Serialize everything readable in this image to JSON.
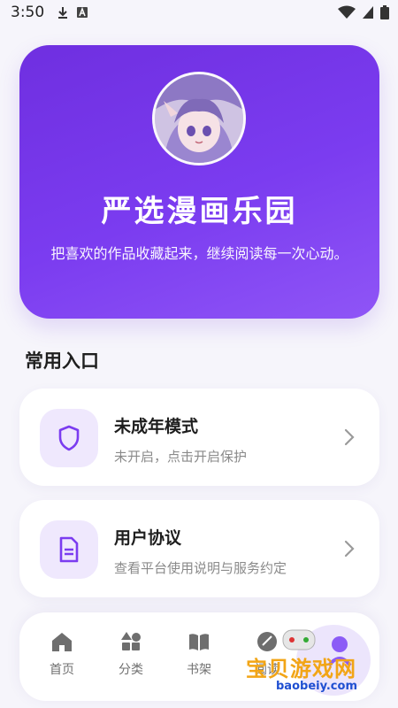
{
  "status_bar": {
    "time": "3:50"
  },
  "hero": {
    "title": "严选漫画乐园",
    "subtitle": "把喜欢的作品收藏起来，继续阅读每一次心动。"
  },
  "section": {
    "title": "常用入口"
  },
  "entries": [
    {
      "title": "未成年模式",
      "desc": "未开启，点击开启保护",
      "icon": "shield-icon"
    },
    {
      "title": "用户协议",
      "desc": "查看平台使用说明与服务约定",
      "icon": "document-icon"
    }
  ],
  "nav": [
    {
      "label": "首页",
      "icon": "home-icon"
    },
    {
      "label": "分类",
      "icon": "category-icon"
    },
    {
      "label": "书架",
      "icon": "book-icon"
    },
    {
      "label": "阅读",
      "icon": "reading-icon"
    }
  ],
  "watermark": {
    "text": "宝贝游戏网",
    "url": "baobeiy.com"
  },
  "colors": {
    "accent": "#7b3cf0",
    "icon_bg": "#efe8fd"
  }
}
